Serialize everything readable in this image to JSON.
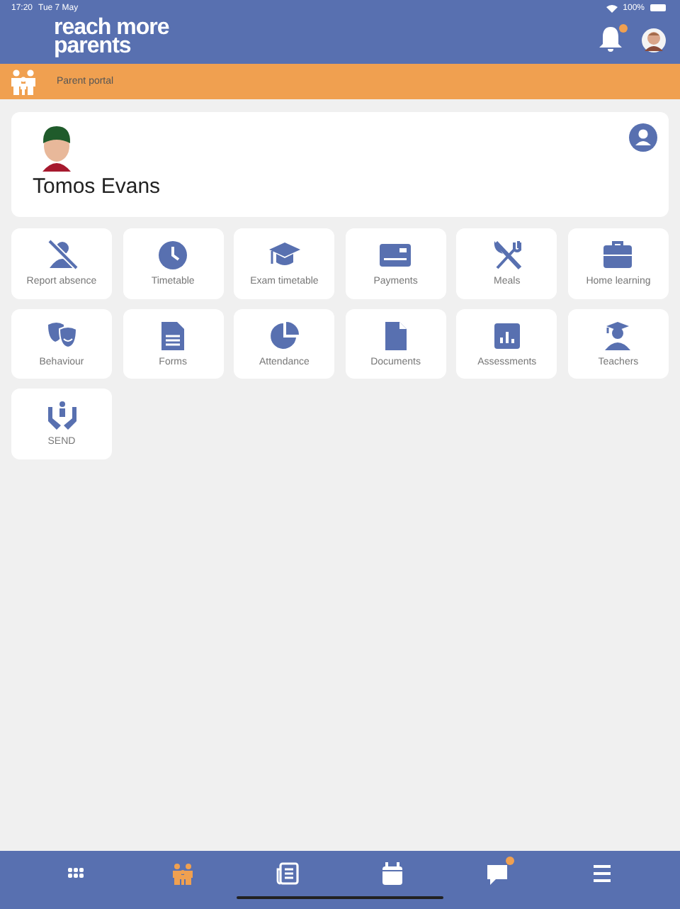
{
  "status_bar": {
    "time": "17:20",
    "date": "Tue 7 May",
    "battery": "100%"
  },
  "header": {
    "logo_lines": [
      "reach more",
      "parents"
    ],
    "notification_badge": true
  },
  "section_bar": {
    "title": "Parent portal"
  },
  "student": {
    "name": "Tomos Evans"
  },
  "tiles": [
    {
      "label": "Report absence"
    },
    {
      "label": "Timetable"
    },
    {
      "label": "Exam timetable"
    },
    {
      "label": "Payments"
    },
    {
      "label": "Meals"
    },
    {
      "label": "Home learning"
    },
    {
      "label": "Behaviour"
    },
    {
      "label": "Forms"
    },
    {
      "label": "Attendance"
    },
    {
      "label": "Documents"
    },
    {
      "label": "Assessments"
    },
    {
      "label": "Teachers"
    },
    {
      "label": "SEND"
    }
  ],
  "tab_bar": [
    {
      "selected": false,
      "badge": false
    },
    {
      "selected": true,
      "badge": false
    },
    {
      "selected": false,
      "badge": false
    },
    {
      "selected": false,
      "badge": false
    },
    {
      "selected": false,
      "badge": true
    },
    {
      "selected": false,
      "badge": false
    }
  ]
}
